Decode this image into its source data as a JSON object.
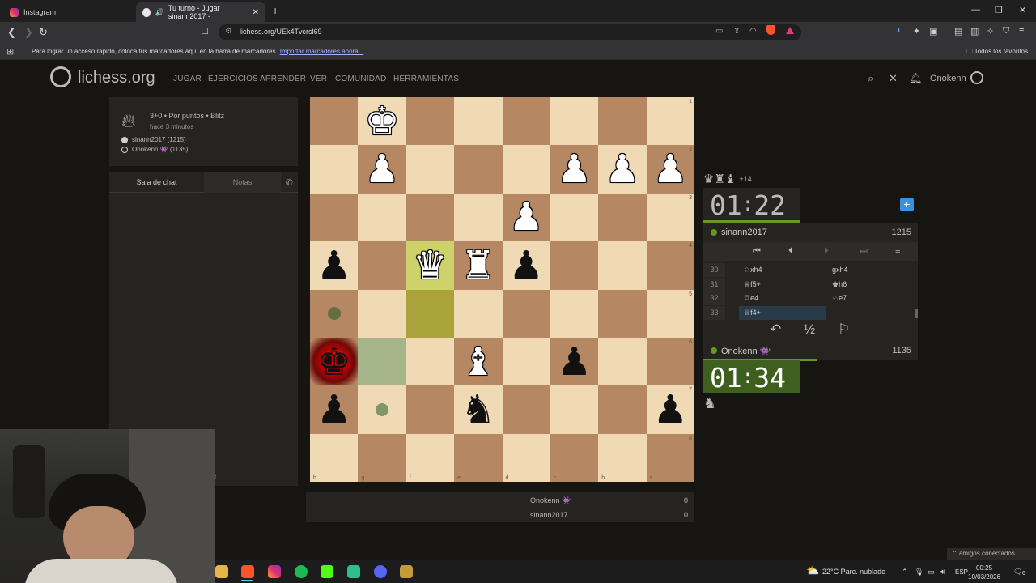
{
  "browser": {
    "tabs": [
      {
        "label": "Instagram"
      },
      {
        "label": "Tu turno - Jugar sinann2017 -"
      }
    ],
    "url": "lichess.org/UEk4Tvcrsl69",
    "bookmarks_msg": "Para lograr un acceso rápido, coloca tus marcadores aquí en la barra de marcadores.",
    "bookmarks_link": "Importar marcadores ahora...",
    "favorites": "Todos los favoritos"
  },
  "site": {
    "logo": "lichess.org",
    "nav": [
      "JUGAR",
      "EJERCICIOS",
      "APRENDER",
      "VER",
      "COMUNIDAD",
      "HERRAMIENTAS"
    ],
    "username": "Onokenn"
  },
  "game": {
    "mode": "3+0 • Por puntos • Blitz",
    "ago": "hace 3 minutos",
    "white_player": "sinann2017 (1215)",
    "black_player": "Onokenn 👾 (1135)"
  },
  "chat": {
    "tab_chat": "Sala de chat",
    "tab_notes": "Notas",
    "input_tail": "t"
  },
  "board": {
    "orientation": "black",
    "rank_labels": [
      "1",
      "2",
      "3",
      "4",
      "5",
      "6",
      "7",
      "8"
    ],
    "file_labels": [
      "h",
      "g",
      "f",
      "e",
      "d",
      "c",
      "b",
      "a"
    ],
    "colors": {
      "light": "#f0d9b5",
      "dark": "#b58863",
      "last_move": "#cdd26a",
      "check": "#e70000"
    },
    "pieces": [
      {
        "sq": "g1",
        "piece": "white-king"
      },
      {
        "sq": "g2",
        "piece": "white-pawn"
      },
      {
        "sq": "c2",
        "piece": "white-pawn"
      },
      {
        "sq": "b2",
        "piece": "white-pawn"
      },
      {
        "sq": "a2",
        "piece": "white-pawn"
      },
      {
        "sq": "d3",
        "piece": "white-pawn"
      },
      {
        "sq": "h4",
        "piece": "black-pawn"
      },
      {
        "sq": "f4",
        "piece": "white-queen"
      },
      {
        "sq": "e4",
        "piece": "white-rook"
      },
      {
        "sq": "d4",
        "piece": "black-pawn"
      },
      {
        "sq": "h6",
        "piece": "black-king"
      },
      {
        "sq": "e6",
        "piece": "white-bishop"
      },
      {
        "sq": "c6",
        "piece": "black-pawn"
      },
      {
        "sq": "h7",
        "piece": "black-pawn"
      },
      {
        "sq": "e7",
        "piece": "black-knight"
      },
      {
        "sq": "a7",
        "piece": "black-pawn"
      }
    ],
    "last_move": [
      "f5",
      "f4"
    ],
    "check": "h6",
    "hover": "g6",
    "move_dots": [
      "h5",
      "g7"
    ]
  },
  "opponent": {
    "name": "sinann2017",
    "rating": "1215",
    "clock_min": "01",
    "clock_sec": "22",
    "material_adv": "+14",
    "clock_fraction": 0.48
  },
  "me": {
    "name": "Onokenn 👾",
    "rating": "1135",
    "clock_min": "01",
    "clock_sec": "34",
    "clock_fraction": 0.53
  },
  "moves": [
    {
      "n": "30",
      "w": "♘xh4",
      "b": "gxh4"
    },
    {
      "n": "31",
      "w": "♕f5+",
      "b": "♚h6"
    },
    {
      "n": "32",
      "w": "♖e4",
      "b": "♘e7"
    },
    {
      "n": "33",
      "w": "♕f4+",
      "b": ""
    }
  ],
  "controls": {
    "draw": "½"
  },
  "scores": [
    {
      "name": "Onokenn 👾",
      "score": "0"
    },
    {
      "name": "sinann2017",
      "score": "0"
    }
  ],
  "taskbar": {
    "weather": "22°C  Parc. nublado",
    "lang": "ESP",
    "time": "00:25",
    "date": "10/03/2026",
    "notif": "6",
    "toast": "amigos conectados"
  }
}
